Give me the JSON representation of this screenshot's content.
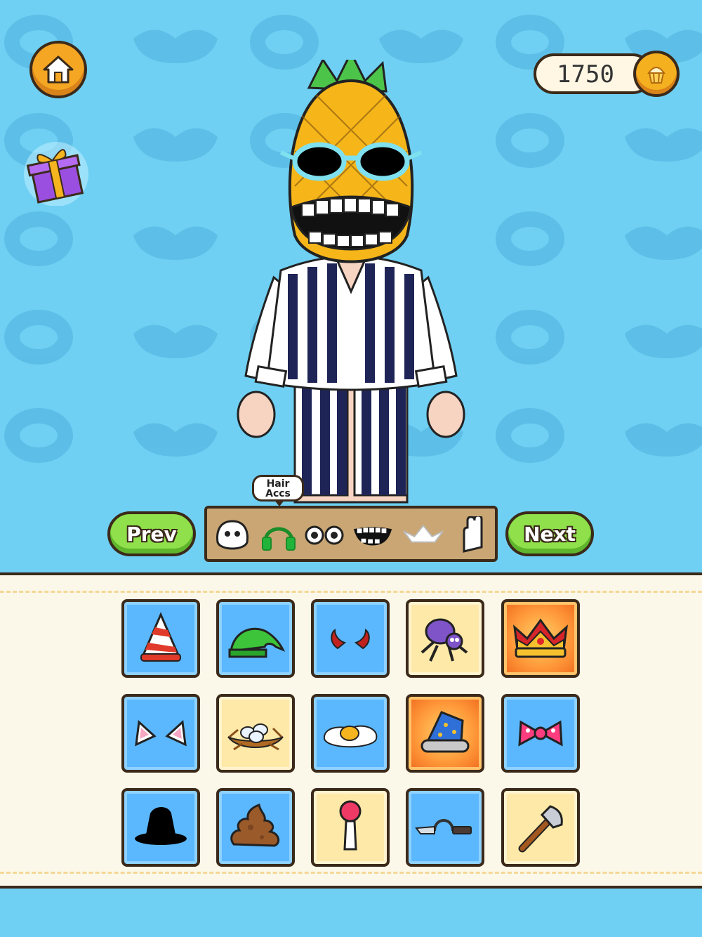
{
  "currency": {
    "coins": "1750",
    "icon": "cupcake-coin-icon"
  },
  "category_tooltip": {
    "line1": "Hair",
    "line2": "Accs"
  },
  "nav": {
    "prev_label": "Prev",
    "next_label": "Next"
  },
  "categories": [
    {
      "name": "face",
      "icon": "face-icon"
    },
    {
      "name": "hair-accessories",
      "icon": "headphones-icon",
      "selected": true
    },
    {
      "name": "eyes",
      "icon": "eyes-icon"
    },
    {
      "name": "mouth",
      "icon": "mouth-icon"
    },
    {
      "name": "hat",
      "icon": "paper-hat-icon"
    },
    {
      "name": "hands",
      "icon": "hand-icon"
    }
  ],
  "items": [
    {
      "icon": "party-hat-icon",
      "style": "blue"
    },
    {
      "icon": "green-elf-hat-icon",
      "style": "blue"
    },
    {
      "icon": "devil-horns-icon",
      "style": "blue"
    },
    {
      "icon": "purple-spider-icon",
      "style": "yellow"
    },
    {
      "icon": "gold-crown-icon",
      "style": "special"
    },
    {
      "icon": "cat-ears-icon",
      "style": "blue"
    },
    {
      "icon": "bird-nest-eggs-icon",
      "style": "yellow"
    },
    {
      "icon": "fried-egg-icon",
      "style": "blue"
    },
    {
      "icon": "wizard-hat-icon",
      "style": "special"
    },
    {
      "icon": "pink-bow-icon",
      "style": "blue"
    },
    {
      "icon": "black-hat-icon",
      "style": "blue"
    },
    {
      "icon": "poop-icon",
      "style": "blue"
    },
    {
      "icon": "pin-icon",
      "style": "yellow"
    },
    {
      "icon": "knife-headband-icon",
      "style": "blue"
    },
    {
      "icon": "axe-icon",
      "style": "yellow"
    }
  ],
  "colors": {
    "background": "#6fd0f3",
    "panel": "#fbf8ea",
    "accent_green": "#8fe04a",
    "accent_orange": "#f5a623"
  }
}
